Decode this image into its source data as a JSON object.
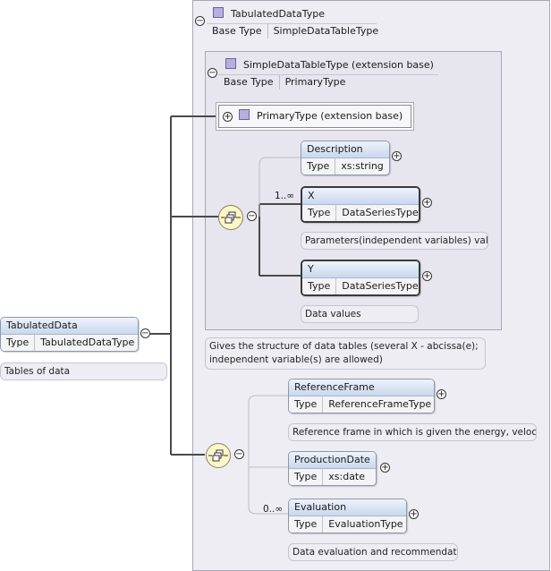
{
  "root": {
    "name": "TabulatedData",
    "type_key": "Type",
    "type_value": "TabulatedDataType",
    "annotation": "Tables of data"
  },
  "outer_type": {
    "name": "TabulatedDataType",
    "base_key": "Base Type",
    "base_value": "SimpleDataTableType"
  },
  "inner_type": {
    "name": "SimpleDataTableType (extension base)",
    "base_key": "Base Type",
    "base_value": "PrimaryType",
    "annotation": "Gives the structure of data tables (several X - abcissa(e); independent variable(s) are allowed)"
  },
  "primary_type": {
    "name": "PrimaryType (extension base)"
  },
  "seq1": {
    "elements": [
      {
        "name": "Description",
        "type_key": "Type",
        "type_value": "xs:string",
        "multiplicity": "",
        "annotation": ""
      },
      {
        "name": "X",
        "type_key": "Type",
        "type_value": "DataSeriesType",
        "multiplicity": "1..∞",
        "annotation": "Parameters(independent variables) values"
      },
      {
        "name": "Y",
        "type_key": "Type",
        "type_value": "DataSeriesType",
        "multiplicity": "",
        "annotation": "Data values"
      }
    ]
  },
  "seq2": {
    "elements": [
      {
        "name": "ReferenceFrame",
        "type_key": "Type",
        "type_value": "ReferenceFrameType",
        "multiplicity": "",
        "annotation": "Reference frame in which is given the energy, velocity..."
      },
      {
        "name": "ProductionDate",
        "type_key": "Type",
        "type_value": "xs:date",
        "multiplicity": "",
        "annotation": ""
      },
      {
        "name": "Evaluation",
        "type_key": "Type",
        "type_value": "EvaluationType",
        "multiplicity": "0..∞",
        "annotation": "Data evaluation and recommendation"
      }
    ]
  },
  "symbols": {
    "expand": "+",
    "collapse": "−"
  },
  "colors": {
    "panel": "#efedf4",
    "header_top": "#eef3fb",
    "header_bottom": "#c9d8ee",
    "sequence_icon": "#fbf7c7",
    "type_square": "#b8aee0"
  }
}
